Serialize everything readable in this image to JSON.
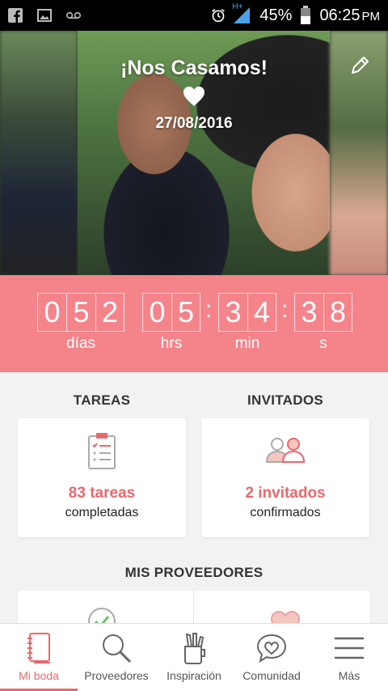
{
  "status_bar": {
    "battery": "45%",
    "time": "06:25",
    "ampm": "PM",
    "network": "H+"
  },
  "hero": {
    "title": "¡Nos Casamos!",
    "date": "27/08/2016"
  },
  "countdown": {
    "days": [
      "0",
      "5",
      "2"
    ],
    "hours": [
      "0",
      "5"
    ],
    "minutes": [
      "3",
      "4"
    ],
    "seconds": [
      "3",
      "8"
    ],
    "labels": {
      "days": "días",
      "hours": "hrs",
      "minutes": "min",
      "seconds": "s"
    }
  },
  "sections": {
    "tareas": {
      "title": "TAREAS",
      "value": "83 tareas",
      "sub": "completadas"
    },
    "invitados": {
      "title": "INVITADOS",
      "value": "2 invitados",
      "sub": "confirmados"
    },
    "proveedores": {
      "title": "MIS PROVEEDORES"
    }
  },
  "nav": {
    "items": [
      {
        "label": "Mi boda",
        "icon": "notebook-icon"
      },
      {
        "label": "Proveedores",
        "icon": "search-icon"
      },
      {
        "label": "Inspiración",
        "icon": "pencil-cup-icon"
      },
      {
        "label": "Comunidad",
        "icon": "heart-chat-icon"
      },
      {
        "label": "Más",
        "icon": "menu-icon"
      }
    ]
  },
  "colors": {
    "accent": "#e8696e",
    "countdown_bg": "#f5838a",
    "page_bg": "#f2f2f2"
  }
}
